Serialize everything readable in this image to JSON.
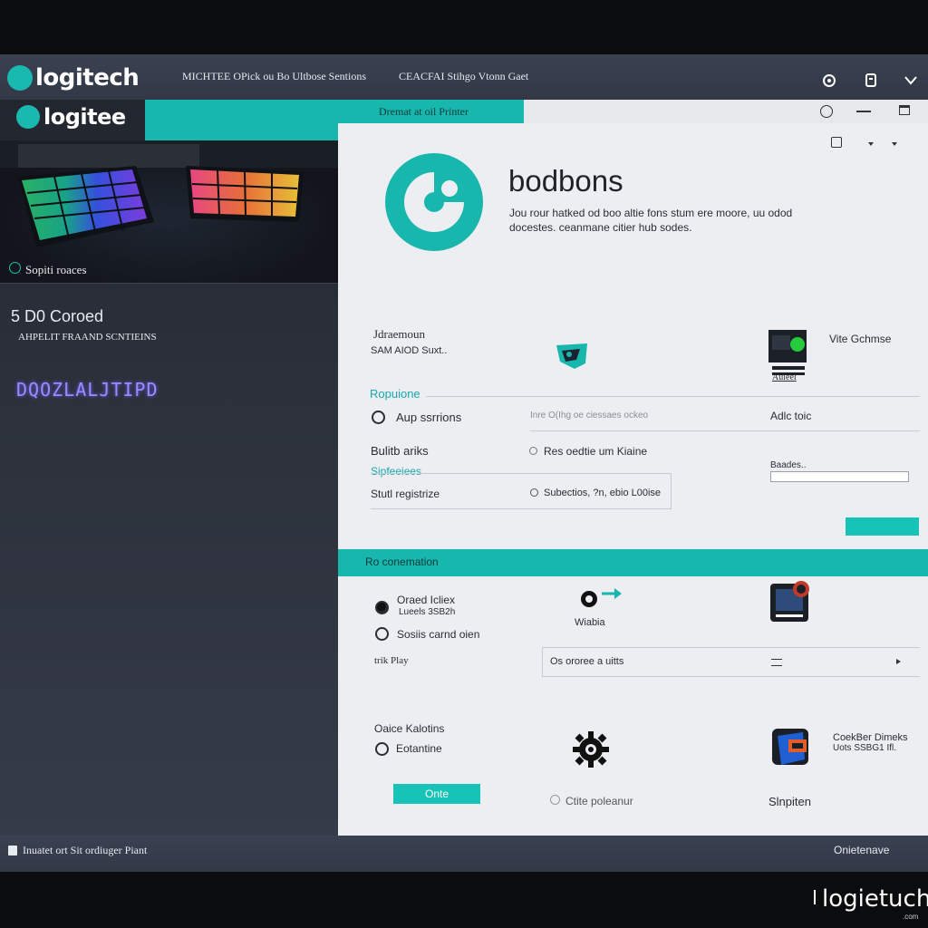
{
  "brand": {
    "primary": "logitech",
    "secondary": "logitee",
    "watermark": "logietuch",
    "watermark_sub": ".com"
  },
  "header": {
    "menu_1": "MICHTEE OPick ou Bo Ultbose Sentions",
    "menu_2": "CEACFAI Stihgo Vtonn Gaet",
    "teal_tab": "Dremat at oil Printer"
  },
  "sidebar": {
    "hero_caption": "Sopiti roaces",
    "heading": "5 D0 Coroed",
    "subheading": "AHPELIT FRAAND SCNTIEINS",
    "neon": "DQOZLALJTIPD"
  },
  "profile": {
    "title": "bodbons",
    "desc_1": "Jou rour hatked od boo altie fons stum ere moore, uu odod",
    "desc_2": "docestes. ceanmane citier hub sodes."
  },
  "section1": {
    "col_title": "Jdraemoun",
    "col_sub": "SAM AIOD Suxt..",
    "right_label": "Vite Gchmse",
    "right_badge": "Auleel",
    "link": "Ropuione",
    "radio_label": "Aup ssrrions",
    "row1_mid": "Inre O(Ihg oe ciessaes ockeo",
    "row1_right": "Adlc toic",
    "build_label": "Bulitb ariks",
    "build_mid": "Res oedtie um Kiaine",
    "sub_link": "Sipfeeiees",
    "status_label": "Stutl registrize",
    "status_mid": "Subectios, ?n, ebio L00ise",
    "progress_label": "Baades..",
    "progress": 0.0
  },
  "section2": {
    "bar_title": "Ro conemation",
    "radio1_label": "Oraed Icliex",
    "radio1_sub": "Lueels 3SB2h",
    "radio2_label": "Sosiis carnd oien",
    "icon1_label": "Wiabia",
    "play_label": "trik Play",
    "dropdown_value": "Os ororee a uitts",
    "option_title": "Oaice Kalotins",
    "radio3_label": "Eotantine",
    "gear_label": "Ctite poleanur",
    "right_title": "CoekBer Dimeks",
    "right_sub": "Uots SSBG1 Ifl.",
    "right_name": "Slnpiten",
    "button": "Onte"
  },
  "footer": {
    "left": "Inuatet ort Sit ordiuger Piant",
    "right": "Onietenave"
  },
  "colors": {
    "accent": "#17b7ad",
    "neon": "#9a8cff",
    "panel": "#eceef1",
    "chrome": "#353b48"
  },
  "icons": [
    "logitech-g-icon",
    "settings-icon",
    "copy-icon",
    "chevron-down-icon",
    "circle-icon",
    "minimize-icon",
    "maximize-icon",
    "profile-logo-icon",
    "game-icon",
    "device-icon",
    "arrow-icon",
    "dark-orb-icon",
    "gear-icon",
    "badge-icon",
    "hamburger-icon",
    "play-arrow-icon"
  ]
}
